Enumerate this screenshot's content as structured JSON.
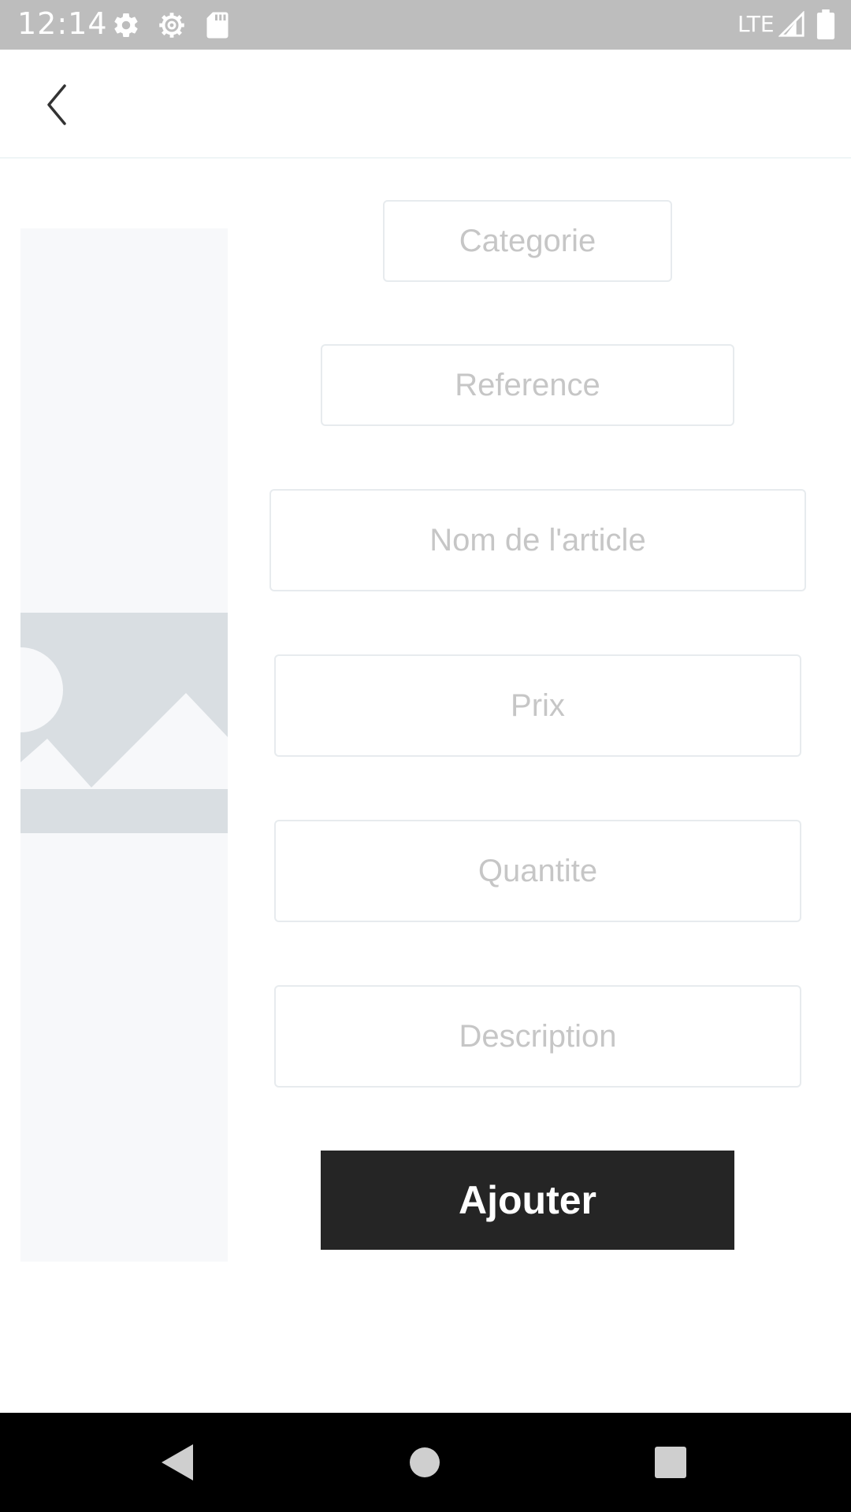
{
  "status_bar": {
    "time": "12:14",
    "network": "LTE",
    "icons": [
      "gear-icon",
      "settings-cog-icon",
      "sd-card-icon",
      "signal-icon",
      "battery-icon"
    ]
  },
  "app_bar": {
    "back_icon": "chevron-left-icon"
  },
  "form": {
    "categorie_placeholder": "Categorie",
    "reference_placeholder": "Reference",
    "nom_placeholder": "Nom de l'article",
    "prix_placeholder": "Prix",
    "quantite_placeholder": "Quantite",
    "description_placeholder": "Description",
    "submit_label": "Ajouter"
  },
  "image_placeholder": {
    "icon": "image-placeholder-icon"
  },
  "nav_bar": {
    "icons": [
      "back-triangle-icon",
      "home-circle-icon",
      "recents-square-icon"
    ]
  },
  "colors": {
    "status_bar": "#bdbdbd",
    "button_bg": "#252525",
    "field_border": "#e7ebee",
    "placeholder_text": "#c6c6c6",
    "image_placeholder_bg": "#f7f8fa",
    "image_placeholder_band": "#d9dee2"
  }
}
